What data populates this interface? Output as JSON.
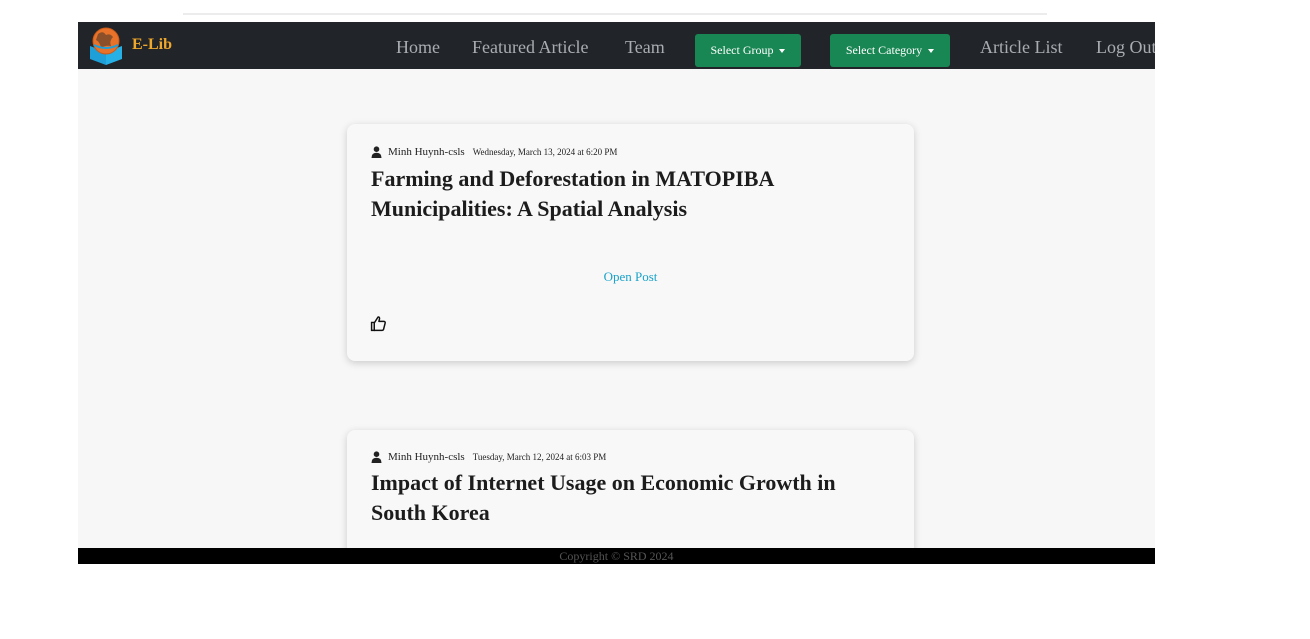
{
  "brand": {
    "name": "E-Lib"
  },
  "nav": {
    "home": "Home",
    "featured": "Featured Article",
    "team": "Team",
    "select_group": "Select Group",
    "select_category": "Select Category",
    "article_list": "Article List",
    "logout": "Log Out"
  },
  "posts": [
    {
      "author": "Minh Huynh-csls",
      "date": "Wednesday, March 13, 2024 at 6:20 PM",
      "title": "Farming and Deforestation in MATOPIBA Municipalities: A Spatial Analysis",
      "open_label": "Open Post"
    },
    {
      "author": "Minh Huynh-csls",
      "date": "Tuesday, March 12, 2024 at 6:03 PM",
      "title": "Impact of Internet Usage on Economic Growth in South Korea"
    }
  ],
  "footer": {
    "copyright": "Copyright © SRD 2024"
  },
  "colors": {
    "navbar": "#212529",
    "brand": "#f0a82c",
    "button": "#198754",
    "link": "#1aa3c9",
    "footer": "#000000"
  },
  "icons": {
    "logo": "book-globe-logo-icon",
    "author": "user-icon",
    "like": "thumbs-up-icon",
    "dropdown": "caret-down-icon"
  }
}
